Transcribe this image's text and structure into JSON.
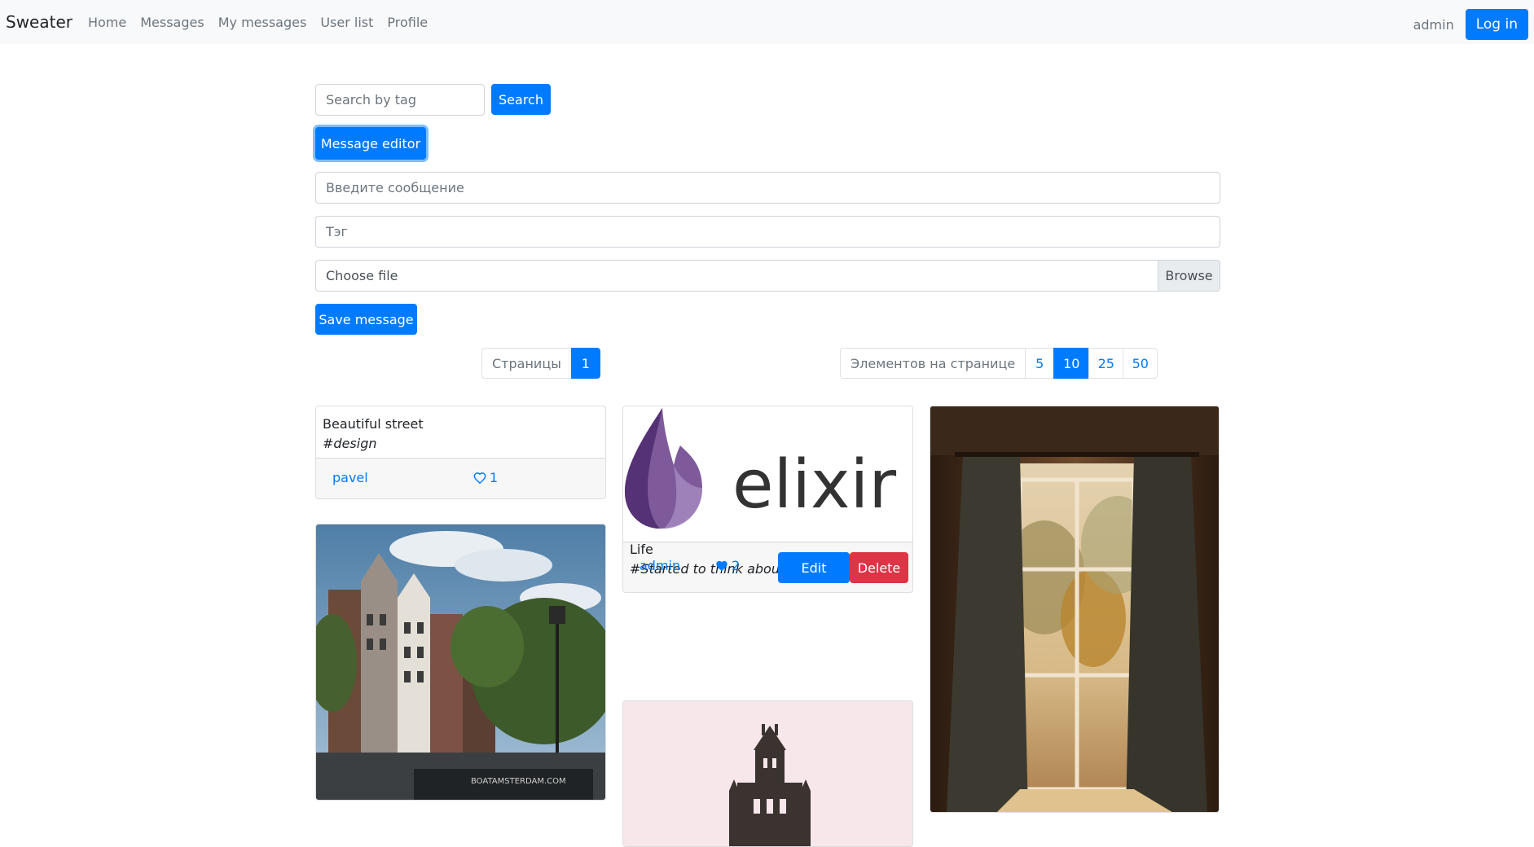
{
  "navbar": {
    "brand": "Sweater",
    "links": [
      "Home",
      "Messages",
      "My messages",
      "User list",
      "Profile"
    ],
    "user": "admin",
    "login_label": "Log in"
  },
  "search": {
    "placeholder": "Search by tag",
    "button_label": "Search"
  },
  "editor": {
    "toggle_label": "Message editor",
    "message_placeholder": "Введите сообщение",
    "tag_placeholder": "Тэг",
    "file_label": "Choose file",
    "browse_label": "Browse",
    "save_label": "Save message"
  },
  "pagination": {
    "pages_label": "Страницы",
    "current_page": "1",
    "size_label": "Элементов на странице",
    "sizes": [
      "5",
      "10",
      "25",
      "50"
    ],
    "active_size": "10"
  },
  "messages": [
    {
      "text": "Beautiful street",
      "tag": "#design",
      "author": "pavel",
      "likes": "1",
      "liked": false,
      "image": "none"
    },
    {
      "text": "Life",
      "tag": "#Started to think about my life",
      "author": "admin",
      "likes": "2",
      "liked": true,
      "image": "elixir-logo",
      "image_text": "elixir",
      "edit_label": "Edit",
      "delete_label": "Delete"
    },
    {
      "image": "amsterdam-street-photo",
      "image_text": "BOATAMSTERDAM.COM"
    },
    {
      "image": "castle-tower-illustration"
    },
    {
      "image": "sunlit-window-photo"
    }
  ],
  "colors": {
    "primary": "#007bff",
    "danger": "#dc3545",
    "navbar_bg": "#f8f9fa",
    "muted": "#6c757d"
  }
}
